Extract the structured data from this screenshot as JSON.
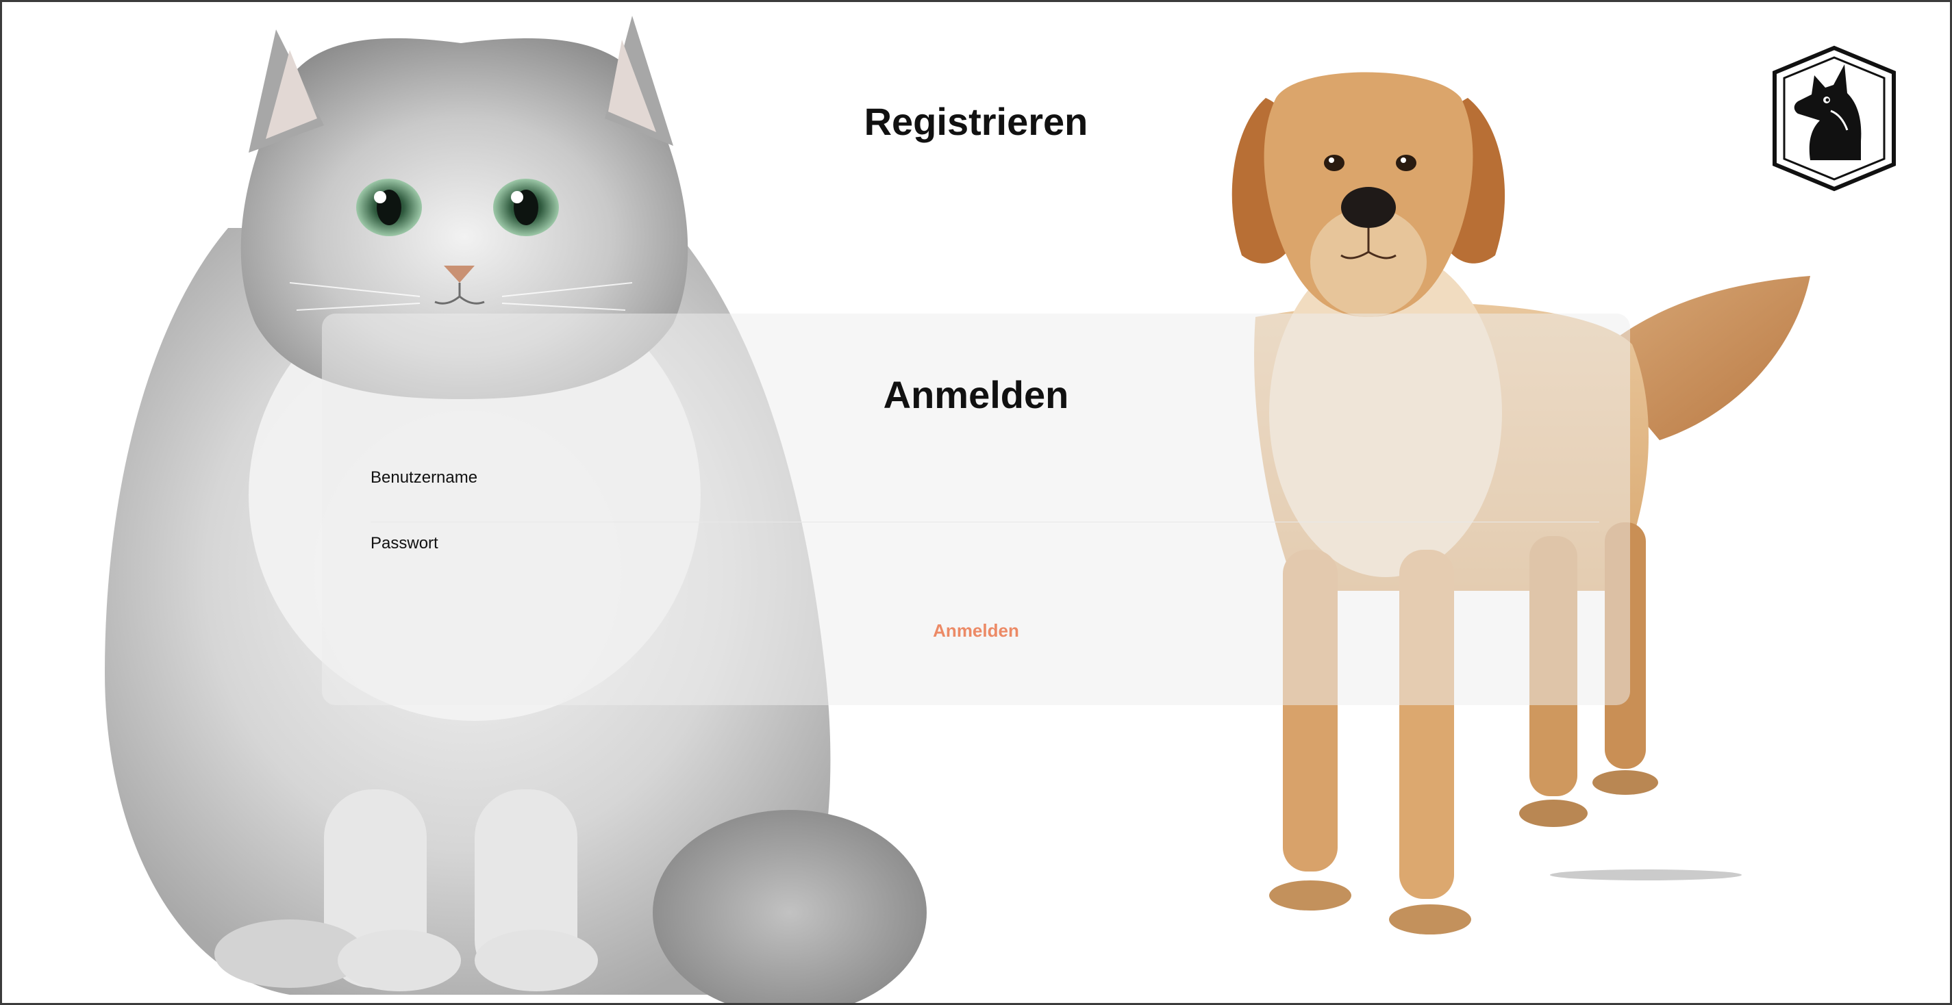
{
  "register": {
    "title": "Registrieren"
  },
  "login": {
    "title": "Anmelden",
    "username_label": "Benutzername",
    "username_value": "",
    "password_label": "Passwort",
    "password_value": "",
    "submit_label": "Anmelden"
  },
  "images": {
    "left": "cat-illustration",
    "right": "dog-illustration",
    "logo": "dog-shield-logo-icon"
  },
  "colors": {
    "accent": "#ec8a66",
    "text": "#111111",
    "card_background": "#eeeeee"
  }
}
